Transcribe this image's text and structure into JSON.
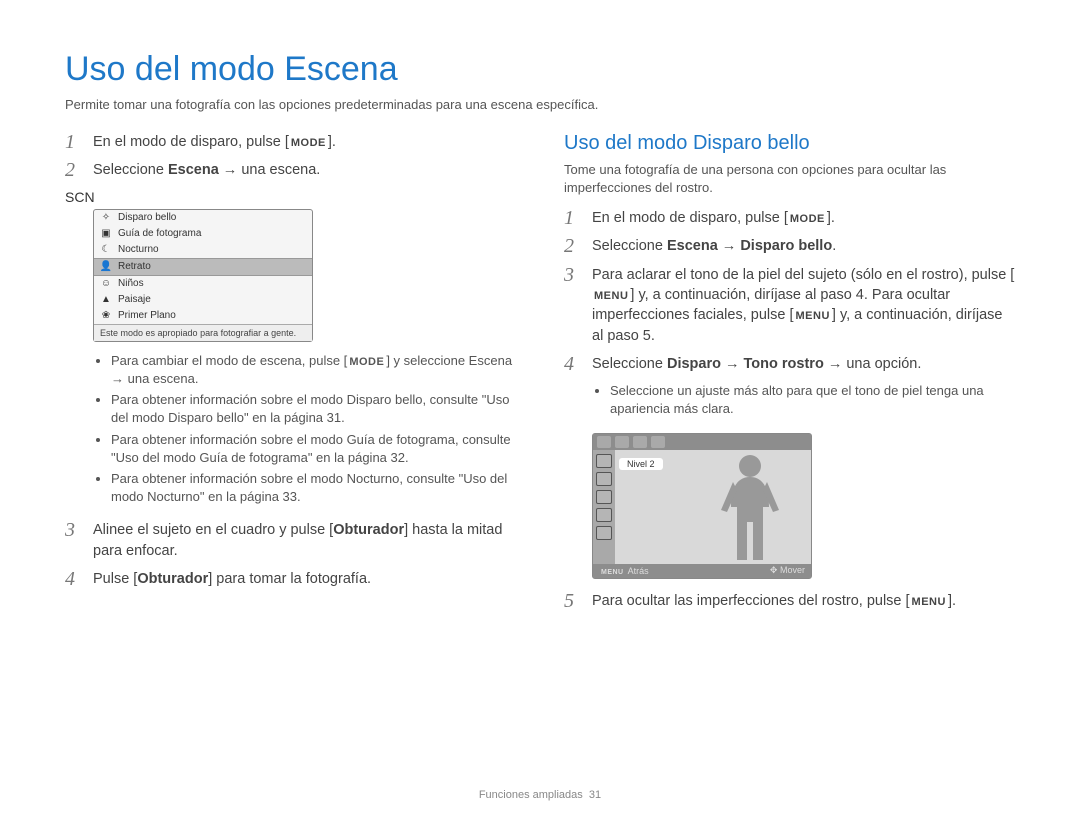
{
  "page": {
    "title": "Uso del modo Escena",
    "intro": "Permite tomar una fotografía con las opciones predeterminadas para una escena específica.",
    "footer_section": "Funciones ampliadas",
    "footer_page": "31"
  },
  "glyphs": {
    "mode": "MODE",
    "menu": "MENU",
    "arrow": "→"
  },
  "left": {
    "step1": "En el modo de disparo, pulse [",
    "step1_end": "].",
    "step2_a": "Seleccione ",
    "step2_b": "Escena",
    "step2_c": " → una escena.",
    "scene_items": [
      {
        "icon": "✧",
        "label": "Disparo bello"
      },
      {
        "icon": "▣",
        "label": "Guía de fotograma"
      },
      {
        "icon": "☾",
        "label": "Nocturno"
      },
      {
        "icon": "👤",
        "label": "Retrato",
        "selected": true
      },
      {
        "icon": "☺",
        "label": "Niños"
      },
      {
        "icon": "▲",
        "label": "Paisaje"
      },
      {
        "icon": "❀",
        "label": "Primer Plano"
      }
    ],
    "scn_badge": "SCN",
    "scene_desc": "Este modo es apropiado para fotografiar a gente.",
    "bullets": [
      {
        "pre": "Para cambiar el modo de escena, pulse [",
        "btn": "MODE",
        "post": "] y seleccione Escena → una escena."
      },
      {
        "text": "Para obtener información sobre el modo Disparo bello, consulte \"Uso del modo Disparo bello\" en la página 31."
      },
      {
        "text": "Para obtener información sobre el modo Guía de fotograma, consulte \"Uso del modo Guía de fotograma\" en la página 32."
      },
      {
        "text": "Para obtener información sobre el modo Nocturno, consulte \"Uso del modo Nocturno\" en la página 33."
      }
    ],
    "step3_a": "Alinee el sujeto en el cuadro y pulse [",
    "step3_b": "Obturador",
    "step3_c": "] hasta la mitad para enfocar.",
    "step4_a": "Pulse [",
    "step4_b": "Obturador",
    "step4_c": "] para tomar la fotografía."
  },
  "right": {
    "title": "Uso del modo Disparo bello",
    "intro": "Tome una fotografía de una persona con opciones para ocultar las imperfecciones del rostro.",
    "step1": "En el modo de disparo, pulse [",
    "step1_end": "].",
    "step2_a": "Seleccione ",
    "step2_b": "Escena",
    "step2_c": " → ",
    "step2_d": "Disparo bello",
    "step2_e": ".",
    "step3_a": "Para aclarar el tono de la piel del sujeto (sólo en el rostro), pulse [",
    "step3_b": "] y, a continuación, diríjase al paso 4. Para ocultar imperfecciones faciales, pulse [",
    "step3_c": "] y, a continuación, diríjase al paso 5.",
    "step4_a": "Seleccione ",
    "step4_b": "Disparo",
    "step4_c": " → ",
    "step4_d": "Tono rostro",
    "step4_e": " → una opción.",
    "step4_bullet": "Seleccione un ajuste más alto para que el tono de piel tenga una apariencia más clara.",
    "cam": {
      "level": "Nivel 2",
      "back": "Atrás",
      "back_btn": "MENU",
      "move": "Mover",
      "move_icon": "✥"
    },
    "step5_a": "Para ocultar las imperfecciones del rostro, pulse [",
    "step5_b": "]."
  }
}
